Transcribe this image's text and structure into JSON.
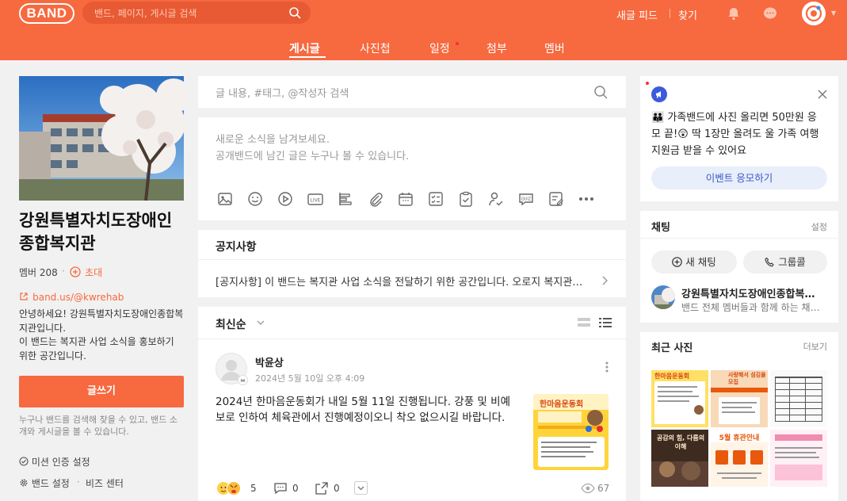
{
  "header": {
    "logo": "BAND",
    "search_placeholder": "밴드, 페이지, 게시글 검색",
    "new_feed": "새글 피드",
    "find": "찾기",
    "colors": {
      "brand": "#f7693f",
      "search_bg": "#e85a33"
    }
  },
  "tabs": [
    {
      "label": "게시글",
      "active": true
    },
    {
      "label": "사진첩"
    },
    {
      "label": "일정",
      "badge": true
    },
    {
      "label": "첨부"
    },
    {
      "label": "멤버"
    }
  ],
  "band": {
    "name": "강원특별자치도장애인종합복지관",
    "members": "멤버 208",
    "invite": "초대",
    "url": "band.us/@kwrehab",
    "description": "안녕하세요! 강원특별자치도장애인종합복지관입니다.\n이 밴드는 복지관 사업 소식을 홍보하기 위한 공간입니다.",
    "write": "글쓰기",
    "help": "누구나 밴드를 검색해 찾을 수 있고, 밴드 소개와 게시글을 볼 수 있습니다.",
    "mission": "미션 인증 설정",
    "settings": "밴드 설정",
    "biz": "비즈 센터"
  },
  "post_search": {
    "placeholder": "글 내용, #태그, @작성자 검색"
  },
  "compose": {
    "line1": "새로운 소식을 남겨보세요.",
    "line2": "공개밴드에 남긴 글은 누구나 볼 수 있습니다.",
    "tools": [
      "image-icon",
      "sticker-icon",
      "video-icon",
      "live-icon",
      "bar-chart-icon",
      "attach-icon",
      "calendar-icon",
      "checklist-icon",
      "clipboard-icon",
      "person-check-icon",
      "quiz-icon",
      "form-icon",
      "more-icon"
    ]
  },
  "notice": {
    "title": "공지사항",
    "text": "[공지사항] 이 밴드는 복지관 사업 소식을 전달하기 위한 공간입니다. 오로지 복지관의 사업 소식을 홍보하기 위해 운영합니다."
  },
  "feed": {
    "sort": "최신순"
  },
  "post": {
    "author": "박윤상",
    "date": "2024년 5월 10일 오후 4:09",
    "body": "2024년 한마음운동회가 내일 5월 11일 진행됩니다. 강풍 및 비예보로 인하여 체육관에서 진행예정이오니 착오 없으시길 바랍니다.",
    "thumb_title": "한마음운동회",
    "reactions": "5",
    "comments": "0",
    "shares": "0",
    "views": "67"
  },
  "ad": {
    "text": "👪 가족밴드에 사진 올리면 50만원 응모 끝!😲 딱 1장만 올려도 울 가족 여행 지원금 받을 수 있어요",
    "button": "이벤트 응모하기"
  },
  "chat": {
    "title": "채팅",
    "settings": "설정",
    "new_chat": "새 채팅",
    "group_call": "그룹콜",
    "room_name": "강원특별자치도장애인종합복지관",
    "room_sub": "밴드 전체 멤버들과 함께 하는 채팅방"
  },
  "photos": {
    "title": "최근 사진",
    "more": "더보기",
    "items": [
      {
        "label": "한마음운동회"
      },
      {
        "label": "사랑해서 섬김을 모집"
      },
      {
        "label": ""
      },
      {
        "label": "공감의 힘, 다름의 이해"
      },
      {
        "label": "5월 휴관안내"
      },
      {
        "label": ""
      }
    ]
  }
}
